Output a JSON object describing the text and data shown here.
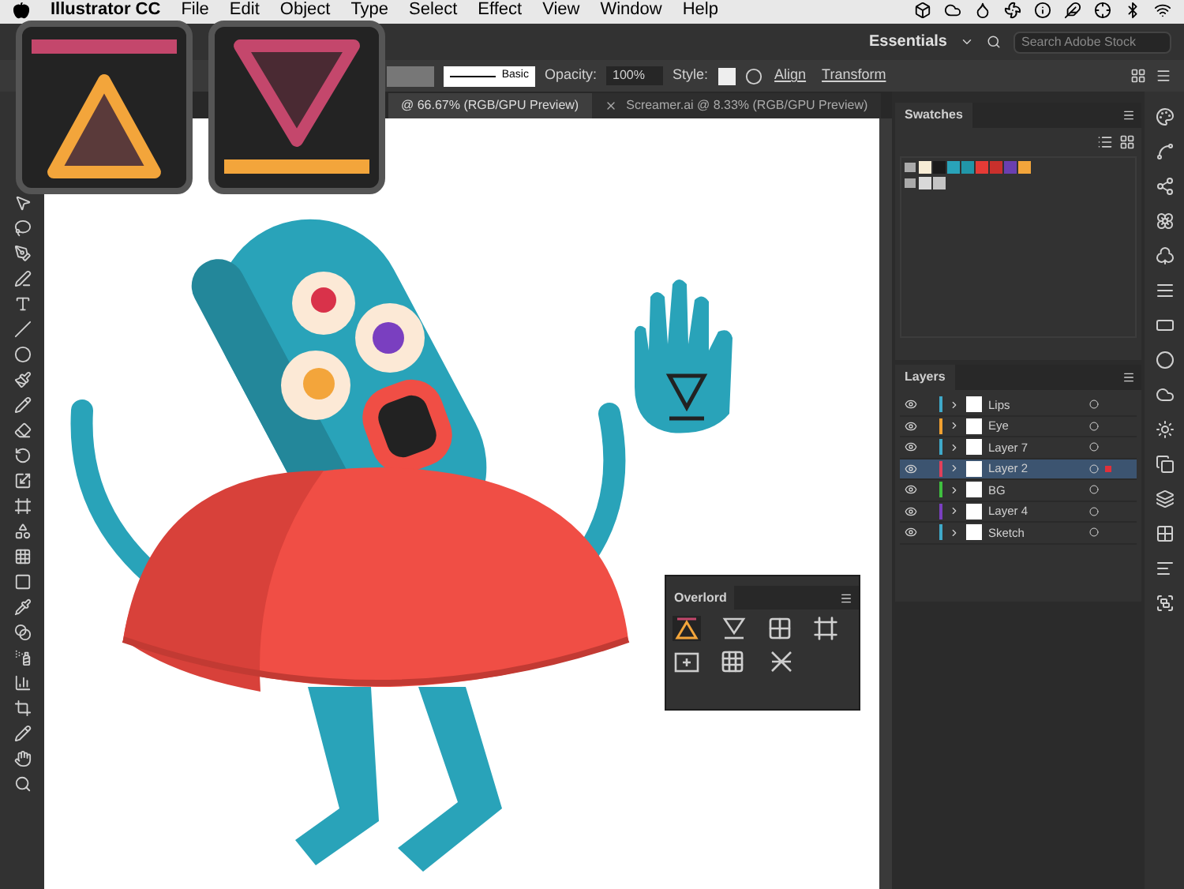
{
  "menu_bar": {
    "app_name": "Illustrator CC",
    "items": [
      "File",
      "Edit",
      "Object",
      "Type",
      "Select",
      "Effect",
      "View",
      "Window",
      "Help"
    ]
  },
  "app_bar": {
    "workspace": "Essentials",
    "search": {
      "placeholder": "Search Adobe Stock"
    }
  },
  "control_bar": {
    "stroke_profile": "Basic",
    "opacity_label": "Opacity:",
    "opacity": "100%",
    "style_label": "Style:",
    "buttons": [
      "Align",
      "Transform"
    ]
  },
  "document_tabs": [
    {
      "label": "@ 66.67% (RGB/GPU Preview)",
      "selected": true
    },
    {
      "label": "Screamer.ai @ 8.33% (RGB/GPU Preview)",
      "selected": false
    }
  ],
  "swatches": {
    "title": "Swatches",
    "groups": [
      {
        "items": [
          {
            "color": "#f7ecd5"
          },
          {
            "color": "#1a1a1a"
          },
          {
            "color": "#29a3b9"
          },
          {
            "color": "#2196a8"
          },
          {
            "color": "#e63b36"
          },
          {
            "color": "#c9302c"
          },
          {
            "color": "#6a3fb0"
          },
          {
            "color": "#f3a53b"
          }
        ]
      },
      {
        "items": [
          {
            "color": "#d9d9d9"
          },
          {
            "color": "#c4c4c4"
          }
        ]
      }
    ]
  },
  "layers": {
    "title": "Layers",
    "items": [
      {
        "name": "Lips",
        "color": "#3fa9c9",
        "selected": false
      },
      {
        "name": "Eye",
        "color": "#f0a030",
        "selected": false
      },
      {
        "name": "Layer 7",
        "color": "#3fa9c9",
        "selected": false
      },
      {
        "name": "Layer 2",
        "color": "#e0405a",
        "selected": true
      },
      {
        "name": "BG",
        "color": "#3fbf3f",
        "selected": false
      },
      {
        "name": "Layer 4",
        "color": "#7a3fc0",
        "selected": false
      },
      {
        "name": "Sketch",
        "color": "#3fa9c9",
        "selected": false
      }
    ]
  },
  "overlord": {
    "title": "Overlord"
  }
}
